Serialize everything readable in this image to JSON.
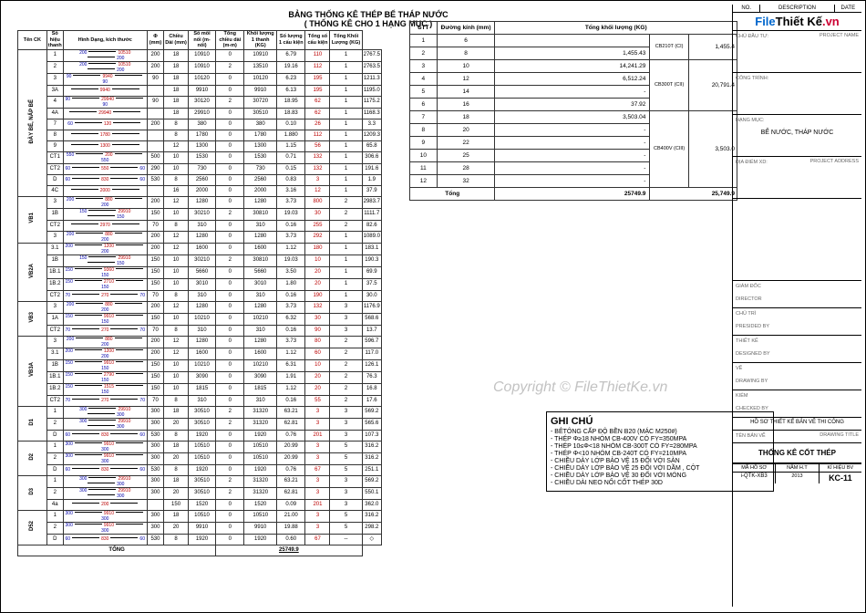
{
  "titles": {
    "t1": "BẢNG THỐNG KÊ THÉP BỂ THÁP NƯỚC",
    "t2": "( THỐNG KÊ CHO 1 HẠNG MỤC )"
  },
  "rebar_headers": [
    "Tên CK",
    "Số hiệu thanh",
    "Hình Dạng, kích thước",
    "Φ (mm)",
    "Chiều Dài (mm)",
    "Số mối nối (m-nối)",
    "Tổng chiều dài (m-m)",
    "Khối lượng 1 thanh (KG)",
    "Số lượng 1 cấu kiện",
    "Tổng số cấu kiện",
    "Tổng Khối Lượng (KG)"
  ],
  "rebar_groups": [
    {
      "name": "ĐÀY BỂ, NẤP BỂ",
      "rows": [
        {
          "sh": "1",
          "shape": "200 — 10510 — 200",
          "phi": "200",
          "d": "18",
          "len": "10910",
          "nn": "0",
          "td": "10910",
          "kl1": "6.79",
          "sl": "110",
          "tc": "1",
          "tkl": "2767.5"
        },
        {
          "sh": "2",
          "shape": "200 — 10510 — 200",
          "phi": "200",
          "d": "18",
          "len": "10910",
          "nn": "2",
          "td": "13510",
          "kl1": "19.16",
          "sl": "112",
          "tc": "1",
          "tkl": "2763.5"
        },
        {
          "sh": "3",
          "shape": "90 — 9940 — 90",
          "phi": "90",
          "d": "18",
          "len": "10120",
          "nn": "0",
          "td": "10120",
          "kl1": "6.23",
          "sl": "195",
          "tc": "1",
          "tkl": "1211.3"
        },
        {
          "sh": "3A",
          "shape": "— 9940 —",
          "phi": "",
          "d": "18",
          "len": "9910",
          "nn": "0",
          "td": "9910",
          "kl1": "6.13",
          "sl": "195",
          "tc": "1",
          "tkl": "1195.0"
        },
        {
          "sh": "4",
          "shape": "90 — 29940 — 90",
          "phi": "90",
          "d": "18",
          "len": "30120",
          "nn": "2",
          "td": "30720",
          "kl1": "18.95",
          "sl": "62",
          "tc": "1",
          "tkl": "1175.2"
        },
        {
          "sh": "4A",
          "shape": "— 29940 —",
          "phi": "",
          "d": "18",
          "len": "29910",
          "nn": "0",
          "td": "30510",
          "kl1": "18.83",
          "sl": "62",
          "tc": "1",
          "tkl": "1168.3"
        },
        {
          "sh": "7",
          "shape": "60 — 120 —",
          "phi": "200",
          "d": "8",
          "len": "380",
          "nn": "0",
          "td": "380",
          "kl1": "0.10",
          "sl": "26",
          "tc": "1",
          "tkl": "3.3"
        },
        {
          "sh": "8",
          "shape": "— 1780 —",
          "phi": "",
          "d": "8",
          "len": "1780",
          "nn": "0",
          "td": "1780",
          "kl1": "1.880",
          "sl": "112",
          "tc": "1",
          "tkl": "1209.3"
        },
        {
          "sh": "9",
          "shape": "— 1300 —",
          "phi": "",
          "d": "12",
          "len": "1300",
          "nn": "0",
          "td": "1300",
          "kl1": "1.15",
          "sl": "56",
          "tc": "1",
          "tkl": "65.8"
        },
        {
          "sh": "CT1",
          "shape": "550 — 200 — 550",
          "phi": "500",
          "d": "10",
          "len": "1530",
          "nn": "0",
          "td": "1530",
          "kl1": "0.71",
          "sl": "132",
          "tc": "1",
          "tkl": "306.6"
        },
        {
          "sh": "CT2",
          "shape": "60 — 550 — 60",
          "phi": "290",
          "d": "10",
          "len": "730",
          "nn": "0",
          "td": "730",
          "kl1": "0.15",
          "sl": "132",
          "tc": "1",
          "tkl": "191.6"
        },
        {
          "sh": "D",
          "shape": "60 — 830 — 60",
          "phi": "530",
          "d": "8",
          "len": "2560",
          "nn": "0",
          "td": "2560",
          "kl1": "0.83",
          "sl": "3",
          "tc": "1",
          "tkl": "1.9"
        },
        {
          "sh": "4C",
          "shape": "— 2000 —",
          "phi": "",
          "d": "16",
          "len": "2000",
          "nn": "0",
          "td": "2000",
          "kl1": "3.16",
          "sl": "12",
          "tc": "1",
          "tkl": "37.9"
        }
      ]
    },
    {
      "name": "VB1",
      "rows": [
        {
          "sh": "3",
          "shape": "200 — 880 — 200",
          "phi": "200",
          "d": "12",
          "len": "1280",
          "nn": "0",
          "td": "1280",
          "kl1": "3.73",
          "sl": "800",
          "tc": "2",
          "tkl": "2983.7"
        },
        {
          "sh": "1B",
          "shape": "150 — 29910 — 150",
          "phi": "150",
          "d": "10",
          "len": "30210",
          "nn": "2",
          "td": "30810",
          "kl1": "19.03",
          "sl": "30",
          "tc": "2",
          "tkl": "1111.7"
        },
        {
          "sh": "CT2",
          "shape": "— 2970 —",
          "phi": "70",
          "d": "8",
          "len": "310",
          "nn": "0",
          "td": "310",
          "kl1": "0.16",
          "sl": "255",
          "tc": "2",
          "tkl": "82.6"
        },
        {
          "sh": "3",
          "shape": "200 — 880 — 200",
          "phi": "200",
          "d": "12",
          "len": "1280",
          "nn": "0",
          "td": "1280",
          "kl1": "3.73",
          "sl": "292",
          "tc": "1",
          "tkl": "1089.0"
        }
      ]
    },
    {
      "name": "VB2A",
      "rows": [
        {
          "sh": "3.1",
          "shape": "200 — 1200 — 200",
          "phi": "200",
          "d": "12",
          "len": "1600",
          "nn": "0",
          "td": "1600",
          "kl1": "1.12",
          "sl": "180",
          "tc": "1",
          "tkl": "183.1"
        },
        {
          "sh": "1B",
          "shape": "150 — 29910 — 150",
          "phi": "150",
          "d": "10",
          "len": "30210",
          "nn": "2",
          "td": "30810",
          "kl1": "19.03",
          "sl": "10",
          "tc": "1",
          "tkl": "190.3"
        },
        {
          "sh": "1B.1",
          "shape": "150 — 9360 — 150",
          "phi": "150",
          "d": "10",
          "len": "5660",
          "nn": "0",
          "td": "5660",
          "kl1": "3.50",
          "sl": "20",
          "tc": "1",
          "tkl": "69.9"
        },
        {
          "sh": "1B.2",
          "shape": "150 — 2710 — 150",
          "phi": "150",
          "d": "10",
          "len": "3010",
          "nn": "0",
          "td": "3010",
          "kl1": "1.80",
          "sl": "20",
          "tc": "1",
          "tkl": "37.5"
        },
        {
          "sh": "CT2",
          "shape": "70 — 270 — 70",
          "phi": "70",
          "d": "8",
          "len": "310",
          "nn": "0",
          "td": "310",
          "kl1": "0.16",
          "sl": "190",
          "tc": "1",
          "tkl": "30.0"
        }
      ]
    },
    {
      "name": "VB3",
      "rows": [
        {
          "sh": "3",
          "shape": "200 — 880 — 200",
          "phi": "200",
          "d": "12",
          "len": "1280",
          "nn": "0",
          "td": "1280",
          "kl1": "3.73",
          "sl": "132",
          "tc": "3",
          "tkl": "1176.9"
        },
        {
          "sh": "1A",
          "shape": "150 — 9910 — 150",
          "phi": "150",
          "d": "10",
          "len": "10210",
          "nn": "0",
          "td": "10210",
          "kl1": "6.32",
          "sl": "30",
          "tc": "3",
          "tkl": "568.6"
        },
        {
          "sh": "CT2",
          "shape": "70 — 270 — 70",
          "phi": "70",
          "d": "8",
          "len": "310",
          "nn": "0",
          "td": "310",
          "kl1": "0.16",
          "sl": "90",
          "tc": "3",
          "tkl": "13.7"
        }
      ]
    },
    {
      "name": "VB3A",
      "rows": [
        {
          "sh": "3",
          "shape": "200 — 880 — 200",
          "phi": "200",
          "d": "12",
          "len": "1280",
          "nn": "0",
          "td": "1280",
          "kl1": "3.73",
          "sl": "80",
          "tc": "2",
          "tkl": "596.7"
        },
        {
          "sh": "3.1",
          "shape": "200 — 1200 — 200",
          "phi": "200",
          "d": "12",
          "len": "1600",
          "nn": "0",
          "td": "1600",
          "kl1": "1.12",
          "sl": "60",
          "tc": "2",
          "tkl": "117.0"
        },
        {
          "sh": "1B",
          "shape": "150 — 9910 — 150",
          "phi": "150",
          "d": "10",
          "len": "10210",
          "nn": "0",
          "td": "10210",
          "kl1": "6.31",
          "sl": "10",
          "tc": "2",
          "tkl": "126.1"
        },
        {
          "sh": "1B.1",
          "shape": "150 — 2790 — 150",
          "phi": "150",
          "d": "10",
          "len": "3090",
          "nn": "0",
          "td": "3090",
          "kl1": "1.91",
          "sl": "20",
          "tc": "2",
          "tkl": "76.3"
        },
        {
          "sh": "1B.2",
          "shape": "150 — 1515 — 150",
          "phi": "150",
          "d": "10",
          "len": "1815",
          "nn": "0",
          "td": "1815",
          "kl1": "1.12",
          "sl": "20",
          "tc": "2",
          "tkl": "16.8"
        },
        {
          "sh": "CT2",
          "shape": "70 — 270 — 70",
          "phi": "70",
          "d": "8",
          "len": "310",
          "nn": "0",
          "td": "310",
          "kl1": "0.16",
          "sl": "55",
          "tc": "2",
          "tkl": "17.6"
        }
      ]
    },
    {
      "name": "D1",
      "rows": [
        {
          "sh": "1",
          "shape": "300 — 29910 — 300",
          "phi": "300",
          "d": "18",
          "len": "30510",
          "nn": "2",
          "td": "31320",
          "kl1": "63.21",
          "sl": "3",
          "tc": "3",
          "tkl": "569.2"
        },
        {
          "sh": "2",
          "shape": "300 — 29910 — 300",
          "phi": "300",
          "d": "20",
          "len": "30510",
          "nn": "2",
          "td": "31320",
          "kl1": "62.81",
          "sl": "3",
          "tc": "3",
          "tkl": "565.6"
        },
        {
          "sh": "D",
          "shape": "60 — 830 — 60",
          "phi": "530",
          "d": "8",
          "len": "1920",
          "nn": "0",
          "td": "1920",
          "kl1": "0.76",
          "sl": "201",
          "tc": "3",
          "tkl": "107.3"
        }
      ]
    },
    {
      "name": "D2",
      "rows": [
        {
          "sh": "1",
          "shape": "300 — 9910 — 300",
          "phi": "300",
          "d": "18",
          "len": "10510",
          "nn": "0",
          "td": "10510",
          "kl1": "20.99",
          "sl": "3",
          "tc": "5",
          "tkl": "316.2"
        },
        {
          "sh": "2",
          "shape": "300 — 9910 — 300",
          "phi": "300",
          "d": "20",
          "len": "10510",
          "nn": "0",
          "td": "10510",
          "kl1": "20.99",
          "sl": "3",
          "tc": "5",
          "tkl": "316.2"
        },
        {
          "sh": "D",
          "shape": "60 — 830 — 60",
          "phi": "530",
          "d": "8",
          "len": "1920",
          "nn": "0",
          "td": "1920",
          "kl1": "0.76",
          "sl": "67",
          "tc": "5",
          "tkl": "251.1"
        }
      ]
    },
    {
      "name": "D3",
      "rows": [
        {
          "sh": "1",
          "shape": "300 — 29910 — 300",
          "phi": "300",
          "d": "18",
          "len": "30510",
          "nn": "2",
          "td": "31320",
          "kl1": "63.21",
          "sl": "3",
          "tc": "3",
          "tkl": "569.2"
        },
        {
          "sh": "2",
          "shape": "300 — 29910 — 300",
          "phi": "300",
          "d": "20",
          "len": "30510",
          "nn": "2",
          "td": "31320",
          "kl1": "62.81",
          "sl": "3",
          "tc": "3",
          "tkl": "550.1"
        },
        {
          "sh": "4a",
          "shape": "— 200 —",
          "phi": "",
          "d": "150",
          "len": "1520",
          "nn": "0",
          "td": "1520",
          "kl1": "0.09",
          "sl": "201",
          "tc": "3",
          "tkl": "362.0"
        }
      ]
    },
    {
      "name": "D52",
      "rows": [
        {
          "sh": "1",
          "shape": "300 — 9910 — 300",
          "phi": "300",
          "d": "18",
          "len": "10510",
          "nn": "0",
          "td": "10510",
          "kl1": "21.00",
          "sl": "3",
          "tc": "5",
          "tkl": "316.2"
        },
        {
          "sh": "2",
          "shape": "300 — 9910 — 300",
          "phi": "300",
          "d": "20",
          "len": "9910",
          "nn": "0",
          "td": "9910",
          "kl1": "19.88",
          "sl": "3",
          "tc": "5",
          "tkl": "298.2"
        },
        {
          "sh": "D",
          "shape": "60 — 830 — 60",
          "phi": "530",
          "d": "8",
          "len": "1920",
          "nn": "0",
          "td": "1920",
          "kl1": "0.60",
          "sl": "67",
          "tc": "--",
          "tkl": "◇"
        }
      ]
    }
  ],
  "rebar_total_label": "TỔNG",
  "rebar_total_value": "25749.9",
  "summary_headers": [
    "STT",
    "Đường kính (mm)",
    "Tổng khối lượng (KG)",
    "",
    ""
  ],
  "summary_rows": [
    {
      "stt": "1",
      "dk": "6",
      "kl": "",
      "grp": "CB210T (CI)",
      "grp_kl": "1,455.4"
    },
    {
      "stt": "2",
      "dk": "8",
      "kl": "1,455.43",
      "grp": "",
      "grp_kl": ""
    },
    {
      "stt": "3",
      "dk": "10",
      "kl": "14,241.29",
      "grp": "CB300T (CII)",
      "grp_kl": "20,791.4"
    },
    {
      "stt": "4",
      "dk": "12",
      "kl": "6,512.24",
      "grp": "",
      "grp_kl": ""
    },
    {
      "stt": "5",
      "dk": "14",
      "kl": "-",
      "grp": "",
      "grp_kl": ""
    },
    {
      "stt": "6",
      "dk": "16",
      "kl": "37.92",
      "grp": "",
      "grp_kl": ""
    },
    {
      "stt": "7",
      "dk": "18",
      "kl": "3,503.04",
      "grp": "CB400V (CIII)",
      "grp_kl": "3,503.0"
    },
    {
      "stt": "8",
      "dk": "20",
      "kl": "-",
      "grp": "",
      "grp_kl": ""
    },
    {
      "stt": "9",
      "dk": "22",
      "kl": "-",
      "grp": "",
      "grp_kl": ""
    },
    {
      "stt": "10",
      "dk": "25",
      "kl": "-",
      "grp": "",
      "grp_kl": ""
    },
    {
      "stt": "11",
      "dk": "28",
      "kl": "-",
      "grp": "",
      "grp_kl": ""
    },
    {
      "stt": "12",
      "dk": "32",
      "kl": "-",
      "grp": "",
      "grp_kl": ""
    }
  ],
  "summary_total_label": "Tổng",
  "summary_total_value": "25749.9",
  "summary_total_right": "25,749.9",
  "ghichu": {
    "title": "GHI CHÚ",
    "lines": [
      "- BÊTÔNG CẤP ĐỘ BỀN B20 (MÁC M250#)",
      "- THÉP Φ≥18 NHÓM CB-400V CÓ FY=350MPA",
      "- THÉP 10≤Φ<18 NHÓM CB-300T CÓ FY=280MPA",
      "- THÉP Φ<10 NHÓM CB-240T CÓ FY=210MPA",
      "- CHIỀU DÀY LỚP BẢO VỆ 15 ĐỐI VỚI SÀN",
      "- CHIỀU DÀY LỚP BẢO VỆ 25 ĐỐI VỚI DẦM , CỘT",
      "- CHIỀU DÀY LỚP BẢO VỆ 30 ĐỐI VỚI MÓNG",
      "- CHIỀU DÀI NEO NỐI CỐT THÉP 30D"
    ]
  },
  "titleblock": {
    "top": {
      "no": "NO.",
      "desc": "DESCRIPTION",
      "date": "DATE"
    },
    "logo_blue": "File",
    "logo_mid": "Thiết Kế",
    "logo_red": ".vn",
    "chudt": "CHỦ ĐẦU TƯ:",
    "project_name": "PROJECT NAME",
    "congtrinh": "CÔNG TRÌNH:",
    "hangmuc_label": "HẠNG MỤC:",
    "hangmuc_value": "BỂ NƯỚC, THÁP NƯỚC",
    "diadiem": "ĐỊA ĐIỂM XD:",
    "project_address": "PROJECT ADDRESS",
    "giamdoc": "GIÁM ĐỐC",
    "director": "DIRECTOR",
    "chutri": "CHỦ TRÌ",
    "presided": "PRESIDED BY",
    "thietke": "THIẾT KẾ",
    "designed": "DESIGNED BY",
    "ve": "VẼ",
    "drawing_by": "DRAWING BY",
    "kiem": "KIỂM",
    "checked": "CHECKED BY",
    "hoso": "HỒ SƠ THIẾT KẾ BẢN VẼ THI CÔNG",
    "tenbanve": "TÊN BẢN VẼ",
    "drawing_title": "DRAWING TITLE",
    "drawing_name": "THỐNG KÊ CỐT THÉP",
    "mahoso": "MÃ HỒ SƠ",
    "namht": "NĂM H.T",
    "kihieu": "KÍ HIỆU BV",
    "code": "i-QTK-XB3",
    "year": "2013",
    "sheet": "KC-11"
  },
  "copyright": "Copyright © FileThietKe.vn"
}
